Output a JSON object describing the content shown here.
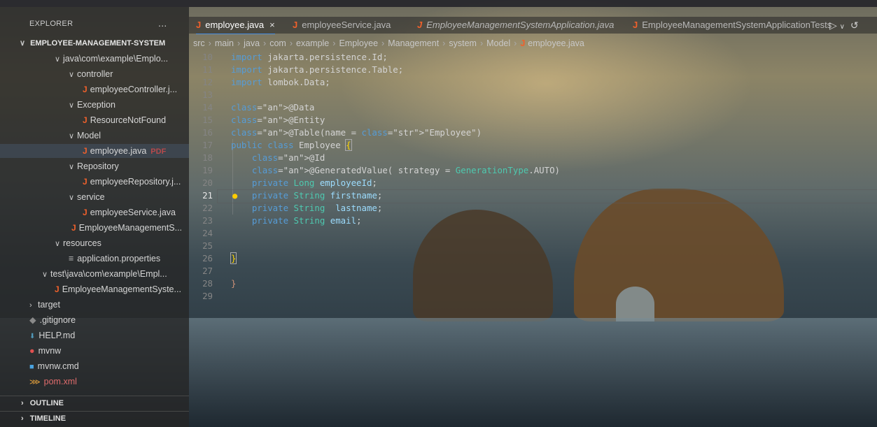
{
  "sidebar": {
    "title": "EXPLORER",
    "more": "...",
    "project": "EMPLOYEE-MANAGEMENT-SYSTEM",
    "items": [
      {
        "label": "java\\com\\example\\Emplo...",
        "kind": "folder-open"
      },
      {
        "label": "controller",
        "kind": "folder-open"
      },
      {
        "label": "employeeController.j...",
        "kind": "java"
      },
      {
        "label": "Exception",
        "kind": "folder-open"
      },
      {
        "label": "ResourceNotFound",
        "kind": "java"
      },
      {
        "label": "Model",
        "kind": "folder-open"
      },
      {
        "label": "employee.java",
        "kind": "java",
        "selected": true
      },
      {
        "label": "Repository",
        "kind": "folder-open"
      },
      {
        "label": "employeeRepository.j...",
        "kind": "java"
      },
      {
        "label": "service",
        "kind": "folder-open"
      },
      {
        "label": "employeeService.java",
        "kind": "java"
      },
      {
        "label": "EmployeeManagementS...",
        "kind": "java"
      },
      {
        "label": "resources",
        "kind": "folder-open"
      },
      {
        "label": "application.properties",
        "kind": "props"
      },
      {
        "label": "test\\java\\com\\example\\Empl...",
        "kind": "folder-open"
      },
      {
        "label": "EmployeeManagementSyste...",
        "kind": "java"
      },
      {
        "label": "target",
        "kind": "folder-closed"
      },
      {
        "label": ".gitignore",
        "kind": "git"
      },
      {
        "label": "HELP.md",
        "kind": "md"
      },
      {
        "label": "mvnw",
        "kind": "mvnw"
      },
      {
        "label": "mvnw.cmd",
        "kind": "cmd"
      },
      {
        "label": "pom.xml",
        "kind": "xml"
      }
    ],
    "pdf_badge": "PDF",
    "outline": "OUTLINE",
    "timeline": "TIMELINE"
  },
  "tabs": [
    {
      "label": "employee.java",
      "active": true,
      "close": "×"
    },
    {
      "label": "employeeService.java",
      "active": false
    },
    {
      "label": "EmployeeManagementSystemApplication.java",
      "active": false,
      "italic": true
    },
    {
      "label": "EmployeeManagementSystemApplicationTests",
      "active": false
    }
  ],
  "breadcrumb": [
    "src",
    "main",
    "java",
    "com",
    "example",
    "Employee",
    "Management",
    "system",
    "Model",
    "employee.java"
  ],
  "code": {
    "current_line": 21,
    "lines": [
      {
        "n": "10",
        "text": "import jakarta.persistence.Id;"
      },
      {
        "n": "11",
        "text": "import jakarta.persistence.Table;"
      },
      {
        "n": "12",
        "text": "import lombok.Data;"
      },
      {
        "n": "13",
        "text": ""
      },
      {
        "n": "14",
        "text": "@Data"
      },
      {
        "n": "15",
        "text": "@Entity"
      },
      {
        "n": "16",
        "text": "@Table(name = \"Employee\")"
      },
      {
        "n": "17",
        "text": "public class Employee {"
      },
      {
        "n": "18",
        "text": "    @Id"
      },
      {
        "n": "19",
        "text": "    @GeneratedValue( strategy = GenerationType.AUTO)"
      },
      {
        "n": "20",
        "text": "    private Long employeeId;"
      },
      {
        "n": "21",
        "text": "    private String firstname;"
      },
      {
        "n": "22",
        "text": "    private String  lastname;"
      },
      {
        "n": "23",
        "text": "    private String email;"
      },
      {
        "n": "24",
        "text": ""
      },
      {
        "n": "25",
        "text": ""
      },
      {
        "n": "26",
        "text": "}"
      },
      {
        "n": "27",
        "text": ""
      },
      {
        "n": "28",
        "text": "}"
      },
      {
        "n": "29",
        "text": ""
      }
    ]
  },
  "colors": {
    "keyword": "#569cd6",
    "type": "#4ec9b0",
    "string": "#ce9178",
    "java_icon": "#f0602b"
  }
}
